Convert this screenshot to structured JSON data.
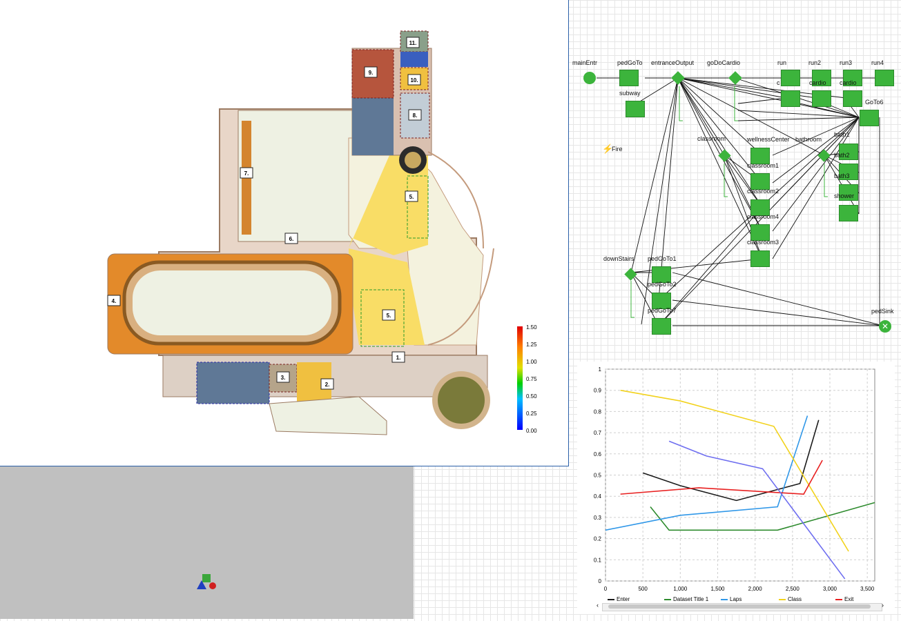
{
  "floor_plan": {
    "rooms": [
      "1.",
      "2.",
      "3.",
      "4.",
      "5.",
      "5.",
      "6.",
      "7.",
      "8.",
      "9.",
      "10.",
      "11."
    ],
    "scale_ticks": [
      "1.50",
      "1.25",
      "1.00",
      "0.75",
      "0.50",
      "0.25",
      "0.00"
    ]
  },
  "flowchart": {
    "blocks": {
      "mainEntr": "mainEntr",
      "pedGoTo": "pedGoTo",
      "entranceOutput": "entranceOutput",
      "goDoCardio": "goDoCardio",
      "run": "run",
      "run2": "run2",
      "run3": "run3",
      "run4": "run4",
      "subway": "subway",
      "cardio": "c",
      "cardio2": "cardio",
      "cardio3": "cardio",
      "goTo6": "GoTo6",
      "fire": "Fire",
      "classroom": "classroom",
      "wellnessCenter": "wellnessCenter",
      "bathroom": "bathroom",
      "bath1": "bath1",
      "bath2": "bath2",
      "bath3": "bath3",
      "shower": "shower",
      "classroom1": "classroom1",
      "classroom2": "classroom2",
      "classroom4": "classroom4",
      "classroom3": "classroom3",
      "downStairs": "downStairs",
      "pedGoTo1": "pedGoTo1",
      "pedGoTo2": "pedGoTo2",
      "pedGoTo7": "pedGoTo7",
      "pedSink": "pedSink"
    }
  },
  "chart_data": {
    "type": "line",
    "xlim": [
      0,
      3600
    ],
    "ylim": [
      0,
      1
    ],
    "x_ticks": [
      "0",
      "500",
      "1,000",
      "1,500",
      "2,000",
      "2,500",
      "3,000",
      "3,500"
    ],
    "y_ticks": [
      "0",
      "0.1",
      "0.2",
      "0.3",
      "0.4",
      "0.5",
      "0.6",
      "0.7",
      "0.8",
      "0.9",
      "1"
    ],
    "grid": true,
    "legend_position": "bottom",
    "series": [
      {
        "name": "Enter",
        "color": "#1a1a1a",
        "x": [
          500,
          1000,
          1750,
          2600,
          2850
        ],
        "y": [
          0.51,
          0.45,
          0.38,
          0.46,
          0.76
        ]
      },
      {
        "name": "Dataset Title 1",
        "color": "#2e8b2e",
        "x": [
          600,
          850,
          2300,
          3600
        ],
        "y": [
          0.35,
          0.24,
          0.24,
          0.37
        ]
      },
      {
        "name": "Laps",
        "color": "#2f97e8",
        "x": [
          0,
          1000,
          2300,
          2700
        ],
        "y": [
          0.24,
          0.31,
          0.35,
          0.78
        ]
      },
      {
        "name": "Class",
        "color": "#f2d21b",
        "x": [
          200,
          1000,
          2250,
          3250
        ],
        "y": [
          0.9,
          0.85,
          0.73,
          0.14
        ]
      },
      {
        "name": "Exit",
        "color": "#e82020",
        "x": [
          200,
          1250,
          2650,
          2900
        ],
        "y": [
          0.41,
          0.44,
          0.41,
          0.57
        ]
      },
      {
        "name": "",
        "color": "#6e6ef0",
        "x": [
          850,
          1350,
          2100,
          3200
        ],
        "y": [
          0.66,
          0.59,
          0.53,
          0.01
        ]
      }
    ]
  }
}
